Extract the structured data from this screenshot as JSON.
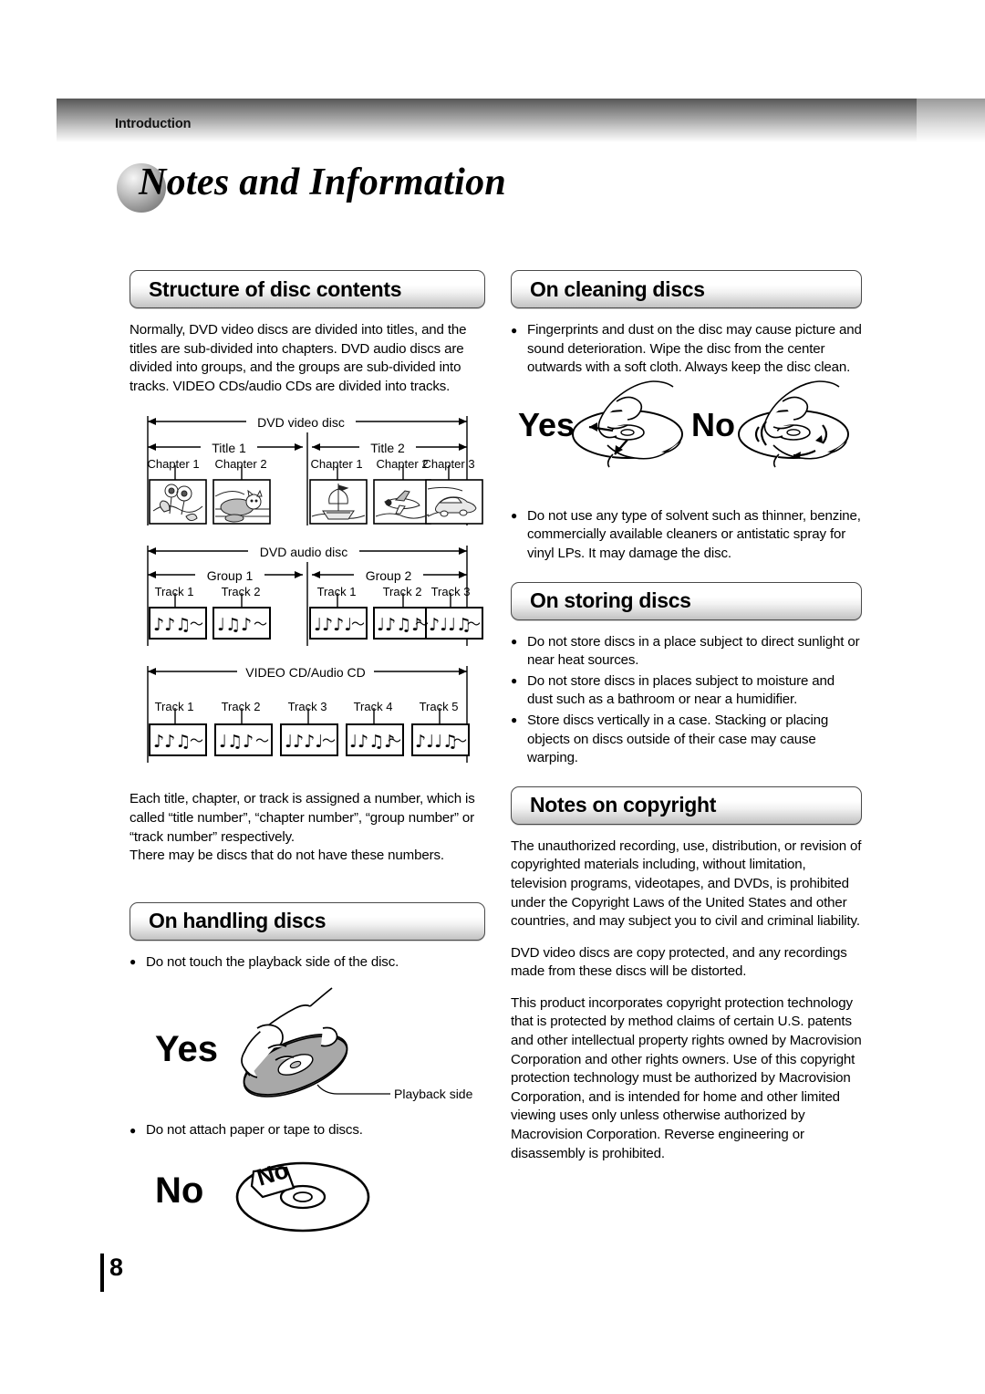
{
  "header": {
    "section_label": "Introduction"
  },
  "title": {
    "text": "Notes and Information",
    "icon": "sphere-bullet"
  },
  "left_column": {
    "structure": {
      "heading": "Structure of disc contents",
      "intro": "Normally, DVD video discs are divided into titles, and the titles are sub-divided into chapters. DVD audio discs are divided into groups, and the groups are sub-divided into tracks. VIDEO CDs/audio CDs are divided into tracks.",
      "diagrams": [
        {
          "name": "dvd-video-disc",
          "title": "DVD video disc",
          "groups": [
            {
              "label": "Title 1",
              "items": [
                "Chapter 1",
                "Chapter 2"
              ],
              "thumbs": [
                "flowers",
                "cat"
              ]
            },
            {
              "label": "Title 2",
              "items": [
                "Chapter 1",
                "Chapter 2",
                "Chapter 3"
              ],
              "thumbs": [
                "sailing-ship",
                "airplane",
                "car"
              ]
            }
          ]
        },
        {
          "name": "dvd-audio-disc",
          "title": "DVD audio disc",
          "groups": [
            {
              "label": "Group 1",
              "items": [
                "Track 1",
                "Track 2"
              ],
              "thumbs": [
                "music-notes",
                "music-notes"
              ]
            },
            {
              "label": "Group 2",
              "items": [
                "Track 1",
                "Track 2",
                "Track 3"
              ],
              "thumbs": [
                "music-notes",
                "music-notes",
                "music-notes"
              ]
            }
          ]
        },
        {
          "name": "video-cd-audio-cd",
          "title": "VIDEO CD/Audio CD",
          "groups": [
            {
              "label": "",
              "items": [
                "Track 1",
                "Track 2",
                "Track 3",
                "Track 4",
                "Track 5"
              ],
              "thumbs": [
                "music-notes",
                "music-notes",
                "music-notes",
                "music-notes",
                "music-notes"
              ]
            }
          ]
        }
      ],
      "outro_1": "Each title, chapter, or track is assigned a number, which is called “title number”, “chapter number”, “group number” or “track number” respectively.",
      "outro_2": "There may be discs that do not have these numbers."
    },
    "handling": {
      "heading": "On handling discs",
      "bullet_1": "Do not touch the playback side of the disc.",
      "illustration_yes": {
        "label": "Yes",
        "callout": "Playback side",
        "icon": "hand-holding-disc-edge"
      },
      "bullet_2": "Do not attach paper or tape to discs.",
      "illustration_no": {
        "label": "No",
        "sticker_label": "No",
        "icon": "disc-with-sticker"
      }
    }
  },
  "right_column": {
    "cleaning": {
      "heading": "On cleaning discs",
      "bullet_1": "Fingerprints and dust on the disc may cause picture and sound deterioration. Wipe the disc from the center outwards with a soft cloth. Always keep the disc clean.",
      "illustration": {
        "yes_label": "Yes",
        "no_label": "No",
        "yes_icon": "hand-wiping-disc-radially",
        "no_icon": "hand-wiping-disc-circularly"
      },
      "bullet_2": "Do not use any type of solvent such as thinner, benzine, commercially available cleaners or antistatic spray for vinyl LPs. It may damage the disc."
    },
    "storing": {
      "heading": "On storing discs",
      "bullets": [
        "Do not store discs in a place subject to direct sunlight or near heat sources.",
        "Do not store discs in places subject to moisture and dust such as a bathroom or near a humidifier.",
        "Store discs vertically in a case. Stacking or placing objects on discs outside of their case may cause warping."
      ]
    },
    "copyright": {
      "heading": "Notes on copyright",
      "paragraphs": [
        "The unauthorized recording, use, distribution, or revision of copyrighted materials including, without limitation, television programs, videotapes, and DVDs, is prohibited under the Copyright Laws of the United States and other countries, and may subject you to civil and criminal liability.",
        "DVD video discs are copy protected, and any recordings made from these discs will be distorted.",
        "This product incorporates copyright protection technology that is protected by method claims of certain U.S. patents and other intellectual property rights owned by Macrovision Corporation and other rights owners. Use of this copyright protection technology must be authorized by Macrovision Corporation, and is intended for home and other limited viewing uses only unless otherwise authorized by Macrovision Corporation. Reverse engineering or disassembly is prohibited."
      ]
    }
  },
  "footer": {
    "page_number": "8"
  }
}
